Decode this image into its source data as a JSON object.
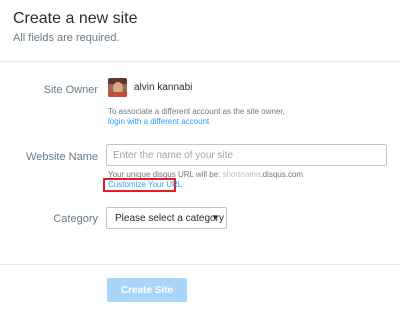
{
  "header": {
    "title": "Create a new site",
    "subtitle": "All fields are required."
  },
  "form": {
    "site_owner": {
      "label": "Site Owner",
      "owner_name": "alvin kannabi",
      "hint": "To associate a different account as the site owner,",
      "hint_link": "login with a different account"
    },
    "website_name": {
      "label": "Website Name",
      "placeholder": "Enter the name of your site",
      "url_hint_prefix": "Your unique disqus URL will be:",
      "url_hint_sample": "shortname",
      "url_hint_suffix": ".disqus.com",
      "customize_link": "Customize Your URL"
    },
    "category": {
      "label": "Category",
      "selected": "Please select a category",
      "caret_icon": "caret-down-icon"
    }
  },
  "actions": {
    "create_label": "Create Site"
  },
  "colors": {
    "link": "#2e9fff",
    "button_disabled": "#a9d5fb",
    "highlight_box": "#e21f26"
  }
}
